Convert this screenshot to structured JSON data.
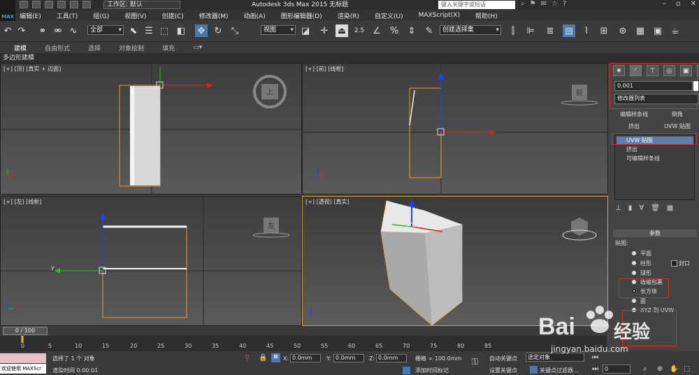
{
  "titlebar": {
    "logo": "MAX",
    "workspace": "工作区: 默认",
    "app_title": "Autodesk 3ds Max  2015     无标题",
    "search_placeholder": "键入关键字或短语"
  },
  "menu": [
    "编辑(E)",
    "工具(T)",
    "组(G)",
    "视图(V)",
    "创建(C)",
    "修改器(M)",
    "动画(A)",
    "图形编辑器(D)",
    "渲染(R)",
    "自定义(U)",
    "MAXScript(X)",
    "帮助(H)"
  ],
  "toolbar": {
    "selection_filter": "全部",
    "ref_coord": "视图",
    "snap_value": "2.5",
    "named_selection": "创建选择集"
  },
  "ribbon": {
    "tabs": [
      "建模",
      "自由形式",
      "选择",
      "对象绘制",
      "填充"
    ],
    "active_tab": "建模",
    "sub_label": "多边形建模"
  },
  "viewports": {
    "top": "[+] [顶] [真实 + 边面]",
    "front": "[+] [前] [线框]",
    "left": "[+] [左] [线框]",
    "persp": "[+] [透视] [真实]",
    "cube_top": "上",
    "cube_front": "前",
    "cube_left": "左"
  },
  "command_panel": {
    "object_name": "0.001",
    "modifier_list": "修改器列表",
    "buttons": [
      "编辑样条线",
      "倒角",
      "挤出",
      "UVW 贴图"
    ],
    "stack": [
      "UVW 贴图",
      "挤出",
      "可编辑样条线"
    ],
    "rollout_title": "参数",
    "mapping_group": "贴图:",
    "mapping_options": [
      "平面",
      "柱形",
      "球形",
      "收缩包裹",
      "长方体",
      "面",
      "XYZ 到 UVW"
    ],
    "selected_mapping": "长方体",
    "cap_label": "封口"
  },
  "timeline": {
    "frame_display": "0 / 100",
    "ticks": [
      "0",
      "5",
      "10",
      "15",
      "20",
      "25",
      "30",
      "35",
      "40",
      "45",
      "50",
      "55",
      "60",
      "65",
      "70",
      "75",
      "80",
      "85"
    ]
  },
  "status": {
    "maxscript_welcome": "欢迎使用 MAXScr",
    "selection_info": "选择了 1 个 对象",
    "render_time": "渲染时间  0:00:01",
    "x_label": "X:",
    "x_value": "0.0mm",
    "y_label": "Y:",
    "y_value": "0.0mm",
    "z_label": "Z:",
    "z_value": "0.0mm",
    "grid": "栅格 = 100.0mm",
    "add_time_tag": "添加时间标记",
    "auto_key": "自动关键点",
    "set_key": "设置关键点",
    "selected_object": "选定对象",
    "key_filters": "关键点过滤器...",
    "frame_value": "0"
  },
  "watermark": {
    "brand": "Bai",
    "brand2": "经验",
    "url": "jingyan.baidu.com"
  },
  "colors": {
    "accent_red": "#d03030",
    "selection_orange": "#e0a030",
    "axis_red": "#e02020",
    "axis_green": "#20c020",
    "axis_blue": "#2040ff"
  }
}
